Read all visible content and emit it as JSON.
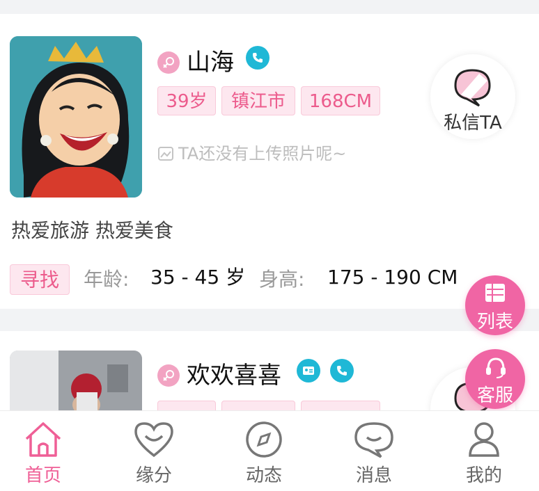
{
  "colors": {
    "accent": "#ef5f96",
    "fab": "#f065a4",
    "tag_bg": "#fde7ef",
    "badge_blue": "#1fb8d6"
  },
  "profiles": [
    {
      "name": "山海",
      "gender_icon": "female-icon",
      "badges": [
        "phone-verified-icon"
      ],
      "tags": [
        "39岁",
        "镇江市",
        "168CM"
      ],
      "no_photo_text": "TA还没有上传照片呢~",
      "message_button": "私信TA",
      "intro": "热爱旅游 热爱美食",
      "seek": {
        "label": "寻找",
        "age_label": "年龄:",
        "age_value": "35 - 45 岁",
        "height_label": "身高:",
        "height_value": "175 - 190 CM"
      }
    },
    {
      "name": "欢欢喜喜",
      "gender_icon": "female-icon",
      "badges": [
        "id-verified-icon",
        "phone-verified-icon"
      ]
    }
  ],
  "floating": {
    "list_label": "列表",
    "service_label": "客服"
  },
  "tabbar": [
    {
      "label": "首页",
      "icon": "home-icon",
      "active": true
    },
    {
      "label": "缘分",
      "icon": "heart-smile-icon",
      "active": false
    },
    {
      "label": "动态",
      "icon": "compass-icon",
      "active": false
    },
    {
      "label": "消息",
      "icon": "chat-bubble-icon",
      "active": false
    },
    {
      "label": "我的",
      "icon": "person-icon",
      "active": false
    }
  ]
}
